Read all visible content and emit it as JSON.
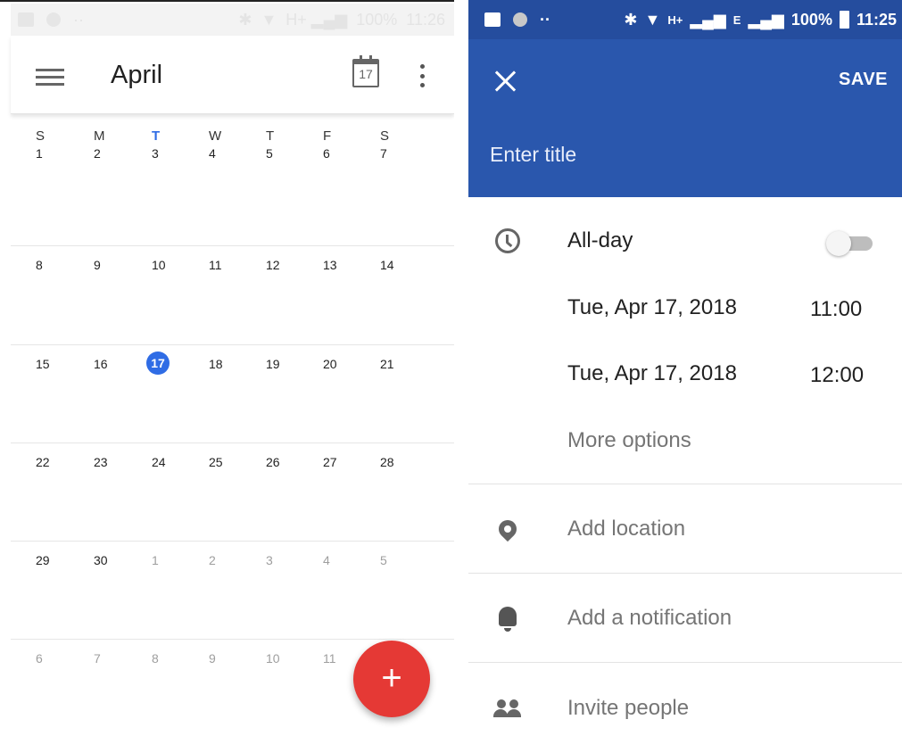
{
  "calendar": {
    "month": "April",
    "calendar_icon_day": "17",
    "weekdays": [
      "S",
      "M",
      "T",
      "W",
      "T",
      "F",
      "S"
    ],
    "weeks": [
      [
        "1",
        "2",
        "3",
        "4",
        "5",
        "6",
        "7"
      ],
      [
        "8",
        "9",
        "10",
        "11",
        "12",
        "13",
        "14"
      ],
      [
        "15",
        "16",
        "17",
        "18",
        "19",
        "20",
        "21"
      ],
      [
        "22",
        "23",
        "24",
        "25",
        "26",
        "27",
        "28"
      ],
      [
        "29",
        "30",
        "1",
        "2",
        "3",
        "4",
        "5"
      ],
      [
        "6",
        "7",
        "8",
        "9",
        "10",
        "11"
      ]
    ],
    "fab_label": "+",
    "status_battery": "100%",
    "status_time": "11:26"
  },
  "event_editor": {
    "status_battery": "100%",
    "status_time": "11:25",
    "status_network": "H+",
    "status_network2": "E",
    "save_label": "SAVE",
    "title_placeholder": "Enter title",
    "all_day_label": "All-day",
    "all_day_on": false,
    "start_date": "Tue, Apr 17, 2018",
    "start_time": "11:00",
    "end_date": "Tue, Apr 17, 2018",
    "end_time": "12:00",
    "more_options": "More options",
    "add_location": "Add location",
    "add_notification": "Add a notification",
    "invite_people": "Invite people",
    "colors": {
      "header": "#2a57ad",
      "status": "#254d9e",
      "fab": "#e53935",
      "today": "#2f6ce5"
    }
  }
}
